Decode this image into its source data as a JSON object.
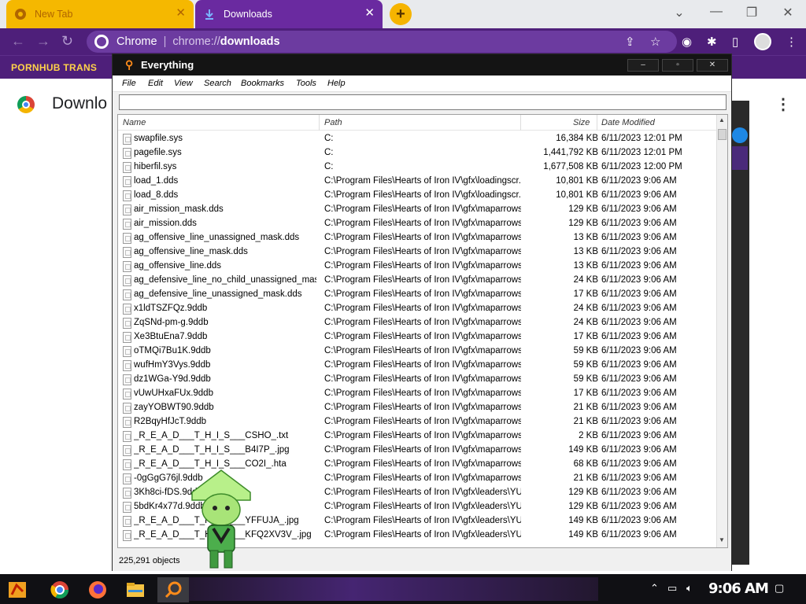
{
  "browser": {
    "tabs": [
      {
        "title": "New Tab"
      },
      {
        "title": "Downloads"
      }
    ],
    "omnibox": {
      "scheme_label": "Chrome",
      "url_prefix": "chrome://",
      "url_path": "downloads"
    },
    "bookmark": "PORNHUB TRANS",
    "page_title": "Downlo"
  },
  "everything": {
    "title": "Everything",
    "menu": [
      "File",
      "Edit",
      "View",
      "Search",
      "Bookmarks",
      "Tools",
      "Help"
    ],
    "search_value": "",
    "columns": {
      "name": "Name",
      "path": "Path",
      "size": "Size",
      "date": "Date Modified"
    },
    "rows": [
      {
        "name": "swapfile.sys",
        "path": "C:",
        "size": "16,384 KB",
        "date": "6/11/2023 12:01 PM"
      },
      {
        "name": "pagefile.sys",
        "path": "C:",
        "size": "1,441,792 KB",
        "date": "6/11/2023 12:01 PM"
      },
      {
        "name": "hiberfil.sys",
        "path": "C:",
        "size": "1,677,508 KB",
        "date": "6/11/2023 12:00 PM"
      },
      {
        "name": "load_1.dds",
        "path": "C:\\Program Files\\Hearts of Iron IV\\gfx\\loadingscr...",
        "size": "10,801 KB",
        "date": "6/11/2023 9:06 AM"
      },
      {
        "name": "load_8.dds",
        "path": "C:\\Program Files\\Hearts of Iron IV\\gfx\\loadingscr...",
        "size": "10,801 KB",
        "date": "6/11/2023 9:06 AM"
      },
      {
        "name": "air_mission_mask.dds",
        "path": "C:\\Program Files\\Hearts of Iron IV\\gfx\\maparrows",
        "size": "129 KB",
        "date": "6/11/2023 9:06 AM"
      },
      {
        "name": "air_mission.dds",
        "path": "C:\\Program Files\\Hearts of Iron IV\\gfx\\maparrows",
        "size": "129 KB",
        "date": "6/11/2023 9:06 AM"
      },
      {
        "name": "ag_offensive_line_unassigned_mask.dds",
        "path": "C:\\Program Files\\Hearts of Iron IV\\gfx\\maparrows",
        "size": "13 KB",
        "date": "6/11/2023 9:06 AM"
      },
      {
        "name": "ag_offensive_line_mask.dds",
        "path": "C:\\Program Files\\Hearts of Iron IV\\gfx\\maparrows",
        "size": "13 KB",
        "date": "6/11/2023 9:06 AM"
      },
      {
        "name": "ag_offensive_line.dds",
        "path": "C:\\Program Files\\Hearts of Iron IV\\gfx\\maparrows",
        "size": "13 KB",
        "date": "6/11/2023 9:06 AM"
      },
      {
        "name": "ag_defensive_line_no_child_unassigned_mas...",
        "path": "C:\\Program Files\\Hearts of Iron IV\\gfx\\maparrows",
        "size": "24 KB",
        "date": "6/11/2023 9:06 AM"
      },
      {
        "name": "ag_defensive_line_unassigned_mask.dds",
        "path": "C:\\Program Files\\Hearts of Iron IV\\gfx\\maparrows",
        "size": "17 KB",
        "date": "6/11/2023 9:06 AM"
      },
      {
        "name": "x1ldTSZFQz.9ddb",
        "path": "C:\\Program Files\\Hearts of Iron IV\\gfx\\maparrows",
        "size": "24 KB",
        "date": "6/11/2023 9:06 AM"
      },
      {
        "name": "ZqSNd-pm-g.9ddb",
        "path": "C:\\Program Files\\Hearts of Iron IV\\gfx\\maparrows",
        "size": "24 KB",
        "date": "6/11/2023 9:06 AM"
      },
      {
        "name": "Xe3BtuEna7.9ddb",
        "path": "C:\\Program Files\\Hearts of Iron IV\\gfx\\maparrows",
        "size": "17 KB",
        "date": "6/11/2023 9:06 AM"
      },
      {
        "name": "oTMQi7Bu1K.9ddb",
        "path": "C:\\Program Files\\Hearts of Iron IV\\gfx\\maparrows",
        "size": "59 KB",
        "date": "6/11/2023 9:06 AM"
      },
      {
        "name": "wufHmY3Vys.9ddb",
        "path": "C:\\Program Files\\Hearts of Iron IV\\gfx\\maparrows",
        "size": "59 KB",
        "date": "6/11/2023 9:06 AM"
      },
      {
        "name": "dz1WGa-Y9d.9ddb",
        "path": "C:\\Program Files\\Hearts of Iron IV\\gfx\\maparrows",
        "size": "59 KB",
        "date": "6/11/2023 9:06 AM"
      },
      {
        "name": "vUwUHxaFUx.9ddb",
        "path": "C:\\Program Files\\Hearts of Iron IV\\gfx\\maparrows",
        "size": "17 KB",
        "date": "6/11/2023 9:06 AM"
      },
      {
        "name": "zayYOBWT90.9ddb",
        "path": "C:\\Program Files\\Hearts of Iron IV\\gfx\\maparrows",
        "size": "21 KB",
        "date": "6/11/2023 9:06 AM"
      },
      {
        "name": "R2BqyHfJcT.9ddb",
        "path": "C:\\Program Files\\Hearts of Iron IV\\gfx\\maparrows",
        "size": "21 KB",
        "date": "6/11/2023 9:06 AM"
      },
      {
        "name": "_R_E_A_D___T_H_I_S___CSHO_.txt",
        "path": "C:\\Program Files\\Hearts of Iron IV\\gfx\\maparrows",
        "size": "2 KB",
        "date": "6/11/2023 9:06 AM"
      },
      {
        "name": "_R_E_A_D___T_H_I_S___B4I7P_.jpg",
        "path": "C:\\Program Files\\Hearts of Iron IV\\gfx\\maparrows",
        "size": "149 KB",
        "date": "6/11/2023 9:06 AM"
      },
      {
        "name": "_R_E_A_D___T_H_I_S___CO2I_.hta",
        "path": "C:\\Program Files\\Hearts of Iron IV\\gfx\\maparrows",
        "size": "68 KB",
        "date": "6/11/2023 9:06 AM"
      },
      {
        "name": "-0gGgG76jl.9ddb",
        "path": "C:\\Program Files\\Hearts of Iron IV\\gfx\\maparrows",
        "size": "21 KB",
        "date": "6/11/2023 9:06 AM"
      },
      {
        "name": "3Kh8ci-fDS.9ddb",
        "path": "C:\\Program Files\\Hearts of Iron IV\\gfx\\leaders\\YUG",
        "size": "129 KB",
        "date": "6/11/2023 9:06 AM"
      },
      {
        "name": "5bdKr4x77d.9ddb",
        "path": "C:\\Program Files\\Hearts of Iron IV\\gfx\\leaders\\YUG",
        "size": "129 KB",
        "date": "6/11/2023 9:06 AM"
      },
      {
        "name": "_R_E_A_D___T_H_I_S___YFFUJA_.jpg",
        "path": "C:\\Program Files\\Hearts of Iron IV\\gfx\\leaders\\YUN",
        "size": "149 KB",
        "date": "6/11/2023 9:06 AM"
      },
      {
        "name": "_R_E_A_D___T_H_I_S___KFQ2XV3V_.jpg",
        "path": "C:\\Program Files\\Hearts of Iron IV\\gfx\\leaders\\YUG",
        "size": "149 KB",
        "date": "6/11/2023 9:06 AM"
      }
    ],
    "status": "225,291 objects"
  },
  "taskbar": {
    "clock": "9:06 AM"
  },
  "colors": {
    "purple": "#4e1f7a",
    "tab_yellow": "#f5b800",
    "tab_active": "#6a2aa0"
  },
  "icons": [
    "chrome-icon",
    "download-icon",
    "close-icon",
    "back-icon",
    "forward-icon",
    "reload-icon",
    "share-icon",
    "star-icon",
    "extensions-icon",
    "sidebar-icon",
    "profile-icon",
    "kebab-menu-icon",
    "everything-icon",
    "file-icon",
    "firefox-icon",
    "folder-icon",
    "volume-icon",
    "network-icon",
    "notification-icon"
  ]
}
